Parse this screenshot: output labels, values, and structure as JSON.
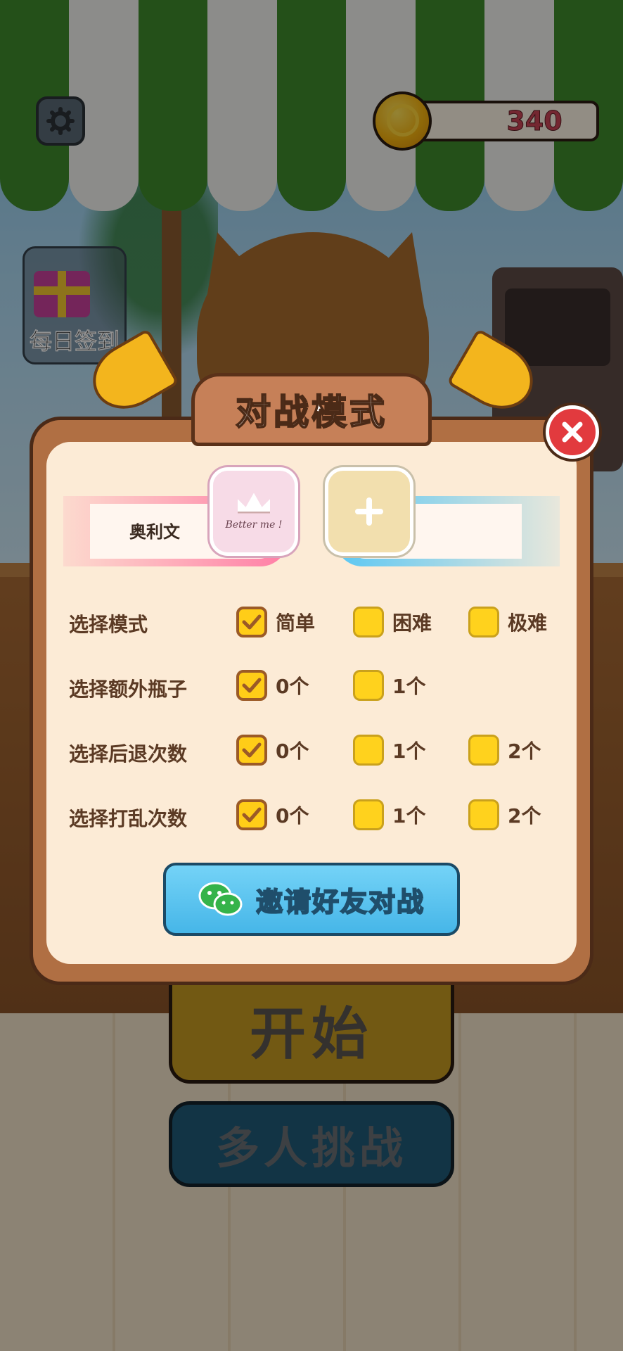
{
  "top_bar": {
    "settings_icon": "gear-icon",
    "coins": "340",
    "coin_icon": "gold-coin-icon"
  },
  "side": {
    "daily_checkin_label": "每日签到",
    "daily_checkin_icon": "gift-box-icon"
  },
  "main_buttons": {
    "start_label": "开始",
    "multiplayer_label": "多人挑战"
  },
  "modal": {
    "title": "对战模式",
    "close_icon": "close-x-icon",
    "player1": {
      "name": "奥利文",
      "avatar_text": "Better me !"
    },
    "player2": {
      "add_icon": "plus-icon"
    },
    "rows": [
      {
        "label": "选择模式",
        "options": [
          {
            "label": "简单",
            "checked": true
          },
          {
            "label": "困难",
            "checked": false
          },
          {
            "label": "极难",
            "checked": false
          }
        ]
      },
      {
        "label": "选择额外瓶子",
        "options": [
          {
            "label": "0个",
            "checked": true
          },
          {
            "label": "1个",
            "checked": false
          }
        ]
      },
      {
        "label": "选择后退次数",
        "options": [
          {
            "label": "0个",
            "checked": true
          },
          {
            "label": "1个",
            "checked": false
          },
          {
            "label": "2个",
            "checked": false
          }
        ]
      },
      {
        "label": "选择打乱次数",
        "options": [
          {
            "label": "0个",
            "checked": true
          },
          {
            "label": "1个",
            "checked": false
          },
          {
            "label": "2个",
            "checked": false
          }
        ]
      }
    ],
    "invite_label": "邀请好友对战",
    "invite_icon": "wechat-icon"
  },
  "colors": {
    "awning_green": "#3f8a2c",
    "modal_frame": "#b06f43",
    "modal_bg": "#fcebd6",
    "checkbox_yellow": "#ffd21d",
    "invite_blue": "#46b6e8",
    "close_red": "#e23a3e",
    "coin_text": "#c94455"
  }
}
